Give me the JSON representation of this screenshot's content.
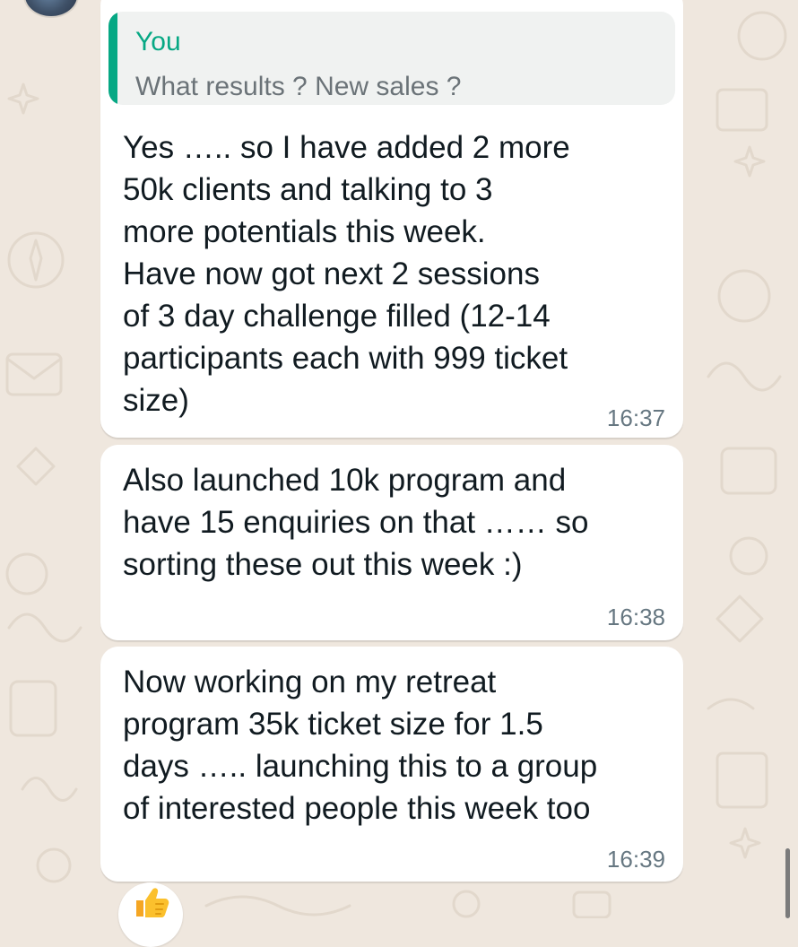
{
  "chat": {
    "messages": [
      {
        "quote": {
          "author": "You",
          "text": "What results ? New sales ?"
        },
        "text": "Yes ….. so I have added 2 more\n50k clients and talking to 3\nmore potentials this week.\nHave now got next 2 sessions\nof 3 day challenge filled (12-14\nparticipants each with 999 ticket\nsize)",
        "time": "16:37"
      },
      {
        "text": "Also launched 10k program and\nhave 15 enquiries on that …… so\nsorting these out this week :)",
        "time": "16:38"
      },
      {
        "text": "Now working on my retreat\nprogram 35k ticket size for 1.5\ndays ….. launching this to a group\nof interested people this week too",
        "time": "16:39"
      }
    ],
    "reaction": "thumbs-up-icon"
  },
  "colors": {
    "background": "#efe7de",
    "bubble": "#ffffff",
    "quote_accent": "#06a884",
    "quote_background": "#f0f2f1",
    "timestamp": "#667781"
  }
}
